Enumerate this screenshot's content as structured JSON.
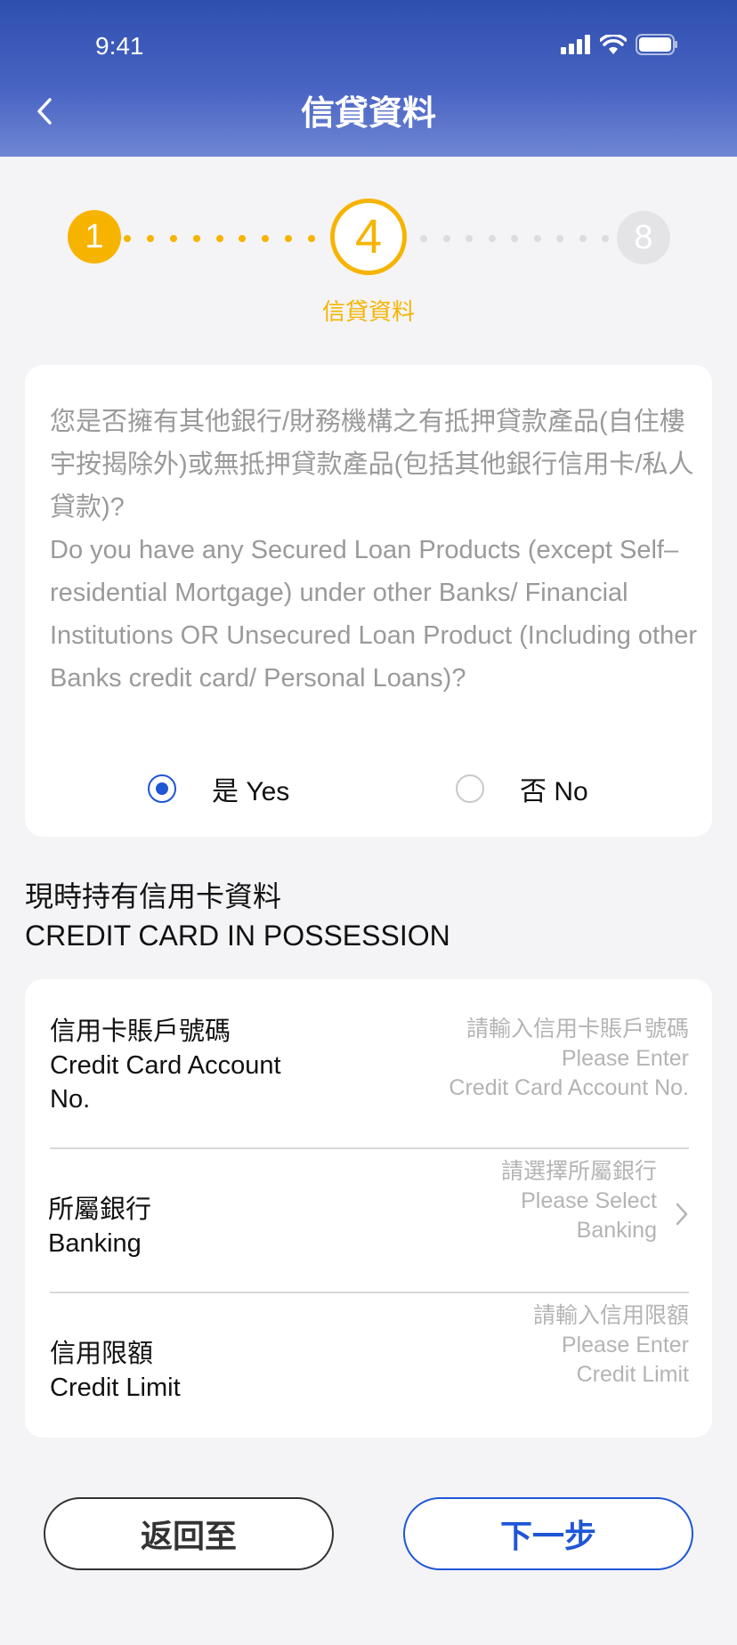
{
  "status_bar": {
    "time": "9:41"
  },
  "header": {
    "title": "信貸資料"
  },
  "progress": {
    "done_step": "1",
    "current_step": "4",
    "last_step": "8",
    "current_label": "信貸資料"
  },
  "question": {
    "text_zh": "您是否擁有其他銀行/財務機構之有抵押貸款產品(自住樓宇按揭除外)或無抵押貸款產品(包括其他銀行信用卡/私人貸款)?",
    "text_en": "Do you have any Secured Loan Products (except Self–residential Mortgage) under other Banks/ Financial Institutions OR Unsecured Loan Product (Including other Banks credit card/ Personal Loans)?",
    "options": [
      {
        "label": "是 Yes",
        "selected": true
      },
      {
        "label": "否 No",
        "selected": false
      }
    ]
  },
  "section": {
    "title_zh": "現時持有信用卡資料",
    "title_en": "CREDIT CARD IN POSSESSION"
  },
  "form": {
    "account": {
      "label_zh": "信用卡賬戶號碼",
      "label_en": "Credit Card Account No.",
      "placeholder_zh": "請輸入信用卡賬戶號碼",
      "placeholder_en_1": "Please Enter",
      "placeholder_en_2": "Credit Card Account No."
    },
    "bank": {
      "label_zh": "所屬銀行",
      "label_en": "Banking",
      "placeholder_zh": "請選擇所屬銀行",
      "placeholder_en_1": "Please Select",
      "placeholder_en_2": "Banking"
    },
    "limit": {
      "label_zh": "信用限額",
      "label_en": "Credit Limit",
      "placeholder_zh": "請輸入信用限額",
      "placeholder_en_1": "Please Enter",
      "placeholder_en_2": "Credit Limit"
    }
  },
  "buttons": {
    "back": "返回至",
    "next": "下一步"
  },
  "colors": {
    "accent": "#1f56d6",
    "step": "#f6b400",
    "header_top": "#2f4fae"
  }
}
